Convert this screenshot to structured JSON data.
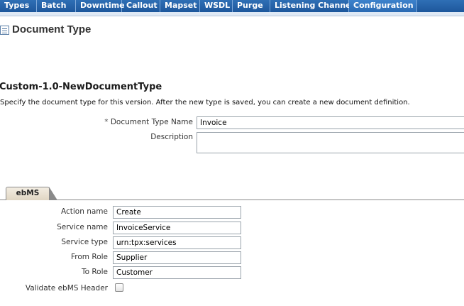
{
  "nav": {
    "tabs": [
      "Types",
      "Batch",
      "Downtime",
      "Callout",
      "Mapset",
      "WSDL",
      "Purge",
      "Listening Channel",
      "Configuration"
    ]
  },
  "page": {
    "title": "Document Type",
    "subtitle": "Custom-1.0-NewDocumentType",
    "instruction": "Specify the document type for this version. After the new type is saved, you can create a new document definition."
  },
  "form": {
    "required_marker": "*",
    "name_label": "Document Type Name",
    "name_value": "Invoice",
    "description_label": "Description",
    "description_value": ""
  },
  "ebms": {
    "tab_label": "ebMS",
    "fields": [
      {
        "label": "Action name",
        "value": "Create"
      },
      {
        "label": "Service name",
        "value": "InvoiceService"
      },
      {
        "label": "Service type",
        "value": "urn:tpx:services"
      },
      {
        "label": "From Role",
        "value": "Supplier"
      },
      {
        "label": "To Role",
        "value": "Customer"
      }
    ],
    "validate_label": "Validate ebMS Header",
    "validate_checked": false
  }
}
